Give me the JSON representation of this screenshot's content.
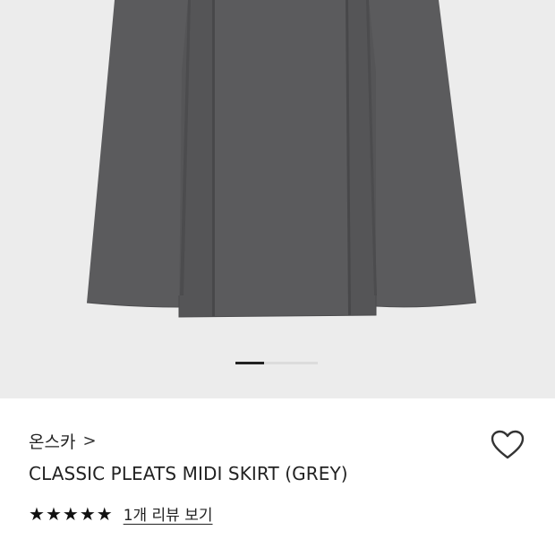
{
  "product": {
    "brand": "온스카",
    "brand_chevron": ">",
    "title": "CLASSIC PLEATS MIDI SKIRT (GREY)",
    "rating_stars": 5,
    "rating_max": 5,
    "review_link": "1개 리뷰 보기"
  },
  "gallery": {
    "current_slide": 1,
    "image_subject": "grey pleated midi skirt"
  },
  "icons": {
    "wishlist": "heart-outline-icon",
    "star": "star-filled-icon",
    "chevron": "chevron-right-icon"
  },
  "colors": {
    "skirt": "#5a5a5c",
    "background": "#ececec",
    "text": "#222222"
  }
}
